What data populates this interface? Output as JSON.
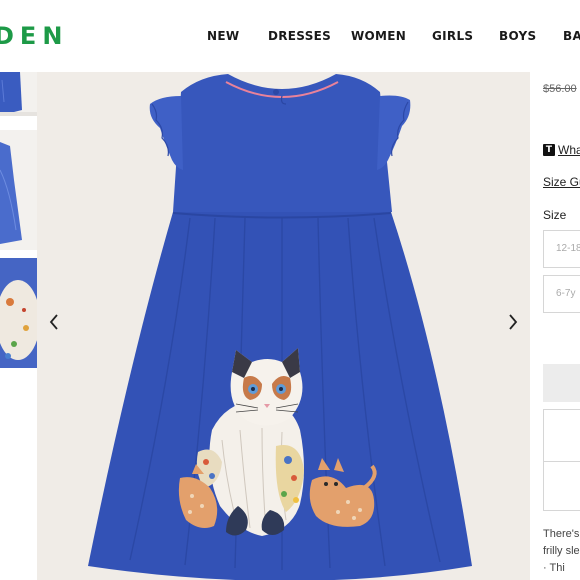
{
  "brand": {
    "logo_text": "DEN",
    "logo_color": "#1d9a47"
  },
  "nav": {
    "items": [
      {
        "label": "NEW"
      },
      {
        "label": "DRESSES"
      },
      {
        "label": "WOMEN"
      },
      {
        "label": "GIRLS"
      },
      {
        "label": "BOYS"
      },
      {
        "label": "BA"
      }
    ]
  },
  "gallery": {
    "main_image": "blue frilly-sleeve dress with cat appliqué",
    "dress_color": "#3352b6",
    "prev_icon": "chevron-left-icon",
    "next_icon": "chevron-right-icon"
  },
  "product": {
    "old_price": "$56.00",
    "tag_icon": "T",
    "tag_link": "Wha",
    "size_guide": "Size Gu",
    "size_label": "Size",
    "sizes": [
      {
        "label": "12-18"
      },
      {
        "label": "6-7y"
      }
    ],
    "description_lines": [
      "There's",
      "frilly sle",
      "· Thi"
    ]
  }
}
